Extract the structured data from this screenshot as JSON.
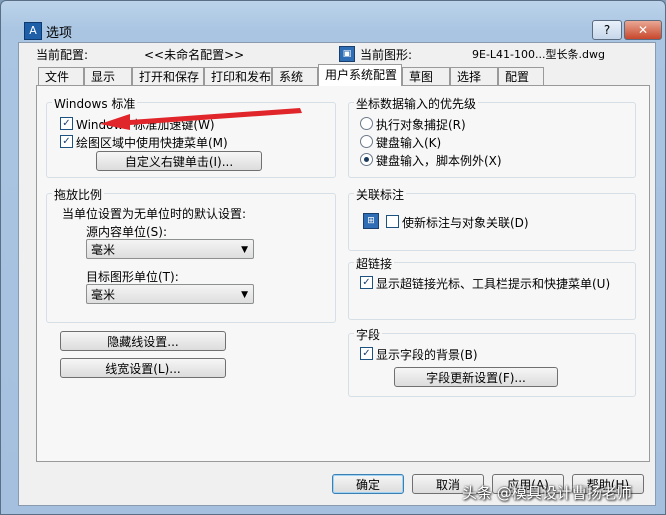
{
  "window": {
    "title": "选项",
    "help": "?",
    "close": "✕"
  },
  "header": {
    "current_profile_label": "当前配置:",
    "current_profile_value": "<<未命名配置>>",
    "current_drawing_label": "当前图形:",
    "current_drawing_value": "9E-L41-100...型长条.dwg"
  },
  "tabs": [
    "文件",
    "显示",
    "打开和保存",
    "打印和发布",
    "系统",
    "用户系统配置",
    "草图",
    "选择",
    "配置"
  ],
  "windows_standard": {
    "title": "Windows 标准",
    "double_click_label": "Windows 标准加速键(W)",
    "shortcut_menu_label": "绘图区域中使用快捷菜单(M)",
    "custom_right_click_button": "自定义右键单击(I)..."
  },
  "scaling": {
    "title": "拖放比例",
    "desc": "当单位设置为无单位时的默认设置:",
    "source_label": "源内容单位(S):",
    "source_value": "毫米",
    "target_label": "目标图形单位(T):",
    "target_value": "毫米"
  },
  "buttons": {
    "hidden_line": "隐藏线设置...",
    "lineweight": "线宽设置(L)..."
  },
  "coord_priority": {
    "title": "坐标数据输入的优先级",
    "options": [
      "执行对象捕捉(R)",
      "键盘输入(K)",
      "键盘输入，脚本例外(X)"
    ],
    "selected_index": 2
  },
  "assoc_dim": {
    "title": "关联标注",
    "checkbox_label": "使新标注与对象关联(D)"
  },
  "hyperlink": {
    "title": "超链接",
    "checkbox_label": "显示超链接光标、工具栏提示和快捷菜单(U)"
  },
  "fields": {
    "title": "字段",
    "checkbox_label": "显示字段的背景(B)",
    "update_button": "字段更新设置(F)..."
  },
  "footer": {
    "ok": "确定",
    "cancel": "取消",
    "apply": "应用(A)",
    "help": "帮助(H)"
  },
  "watermark": "头条 @模具设计曹扬老师",
  "colors": {
    "window_frame": "#a4c0de",
    "annotation_arrow": "#e0262a"
  }
}
